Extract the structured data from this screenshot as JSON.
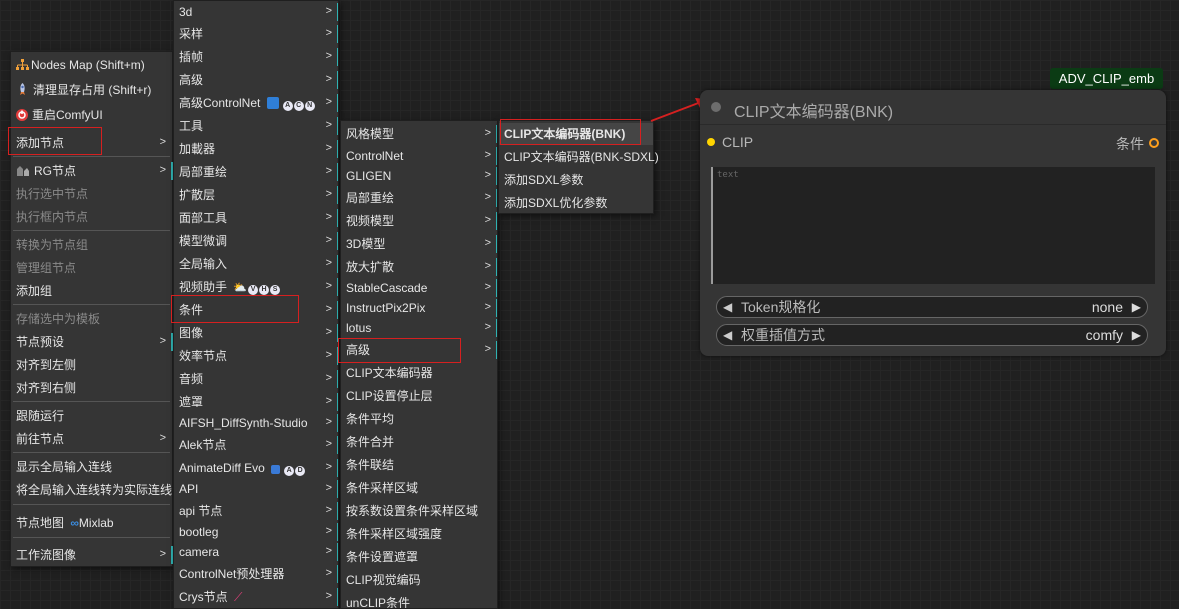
{
  "menu1": {
    "items": [
      {
        "label": "Nodes Map (Shift+m)",
        "icon": "sitemap-icon"
      },
      {
        "label": "清理显存占用 (Shift+r)",
        "icon": "rocket-icon"
      },
      {
        "label": "重启ComfyUI",
        "icon": "restart-icon"
      },
      {
        "label": "添加节点"
      },
      {
        "label": "RG节点",
        "icon": "rg-icon"
      },
      {
        "label": "执行选中节点"
      },
      {
        "label": "执行框内节点"
      },
      {
        "label": "转换为节点组"
      },
      {
        "label": "管理组节点"
      },
      {
        "label": "添加组"
      },
      {
        "label": "存储选中为模板"
      },
      {
        "label": "节点预设"
      },
      {
        "label": "对齐到左侧"
      },
      {
        "label": "对齐到右侧"
      },
      {
        "label": "跟随运行"
      },
      {
        "label": "前往节点"
      },
      {
        "label": "显示全局输入连线"
      },
      {
        "label": "将全局输入连线转为实际连线"
      },
      {
        "label": "节点地图"
      },
      {
        "label": "工作流图像"
      }
    ],
    "mixlab_label": "Mixlab"
  },
  "menu2": {
    "items": [
      "3d",
      "采样",
      "插帧",
      "高级",
      "高级ControlNet",
      "工具",
      "加載器",
      "局部重绘",
      "扩散层",
      "面部工具",
      "模型微调",
      "全局输入",
      "视频助手",
      "条件",
      "图像",
      "效率节点",
      "音频",
      "遮罩",
      "AIFSH_DiffSynth-Studio",
      "Alek节点",
      "AnimateDiff Evo",
      "API",
      "api 节点",
      "bootleg",
      "camera",
      "ControlNet预处理器",
      "Crys节点"
    ],
    "badges": {
      "controlnet": [
        "A",
        "C",
        "N"
      ],
      "video": [
        "V",
        "H",
        "S"
      ],
      "animatediff": [
        "A",
        "D"
      ]
    }
  },
  "menu3": {
    "items": [
      "风格模型",
      "ControlNet",
      "GLIGEN",
      "局部重绘",
      "视频模型",
      "3D模型",
      "放大扩散",
      "StableCascade",
      "InstructPix2Pix",
      "lotus",
      "高级",
      "CLIP文本编码器",
      "CLIP设置停止层",
      "条件平均",
      "条件合并",
      "条件联结",
      "条件采样区域",
      "按系数设置条件采样区域",
      "条件采样区域强度",
      "条件设置遮罩",
      "CLIP视觉编码",
      "unCLIP条件"
    ]
  },
  "menu4": {
    "items": [
      "CLIP文本编码器(BNK)",
      "CLIP文本编码器(BNK-SDXL)",
      "添加SDXL参数",
      "添加SDXL优化参数"
    ]
  },
  "node": {
    "tag": "ADV_CLIP_emb",
    "title": "CLIP文本编码器(BNK)",
    "input_label": "CLIP",
    "output_label": "条件",
    "text_placeholder": "text",
    "widgets": [
      {
        "label": "Token规格化",
        "value": "none"
      },
      {
        "label": "权重插值方式",
        "value": "comfy"
      }
    ]
  },
  "colors": {
    "accent_bar": "#2fb2b2",
    "highlight_border": "#d62020",
    "node_tag_bg": "#0b3b14",
    "input_dot": "#ffd500",
    "output_dot": "#ff9f1c"
  }
}
